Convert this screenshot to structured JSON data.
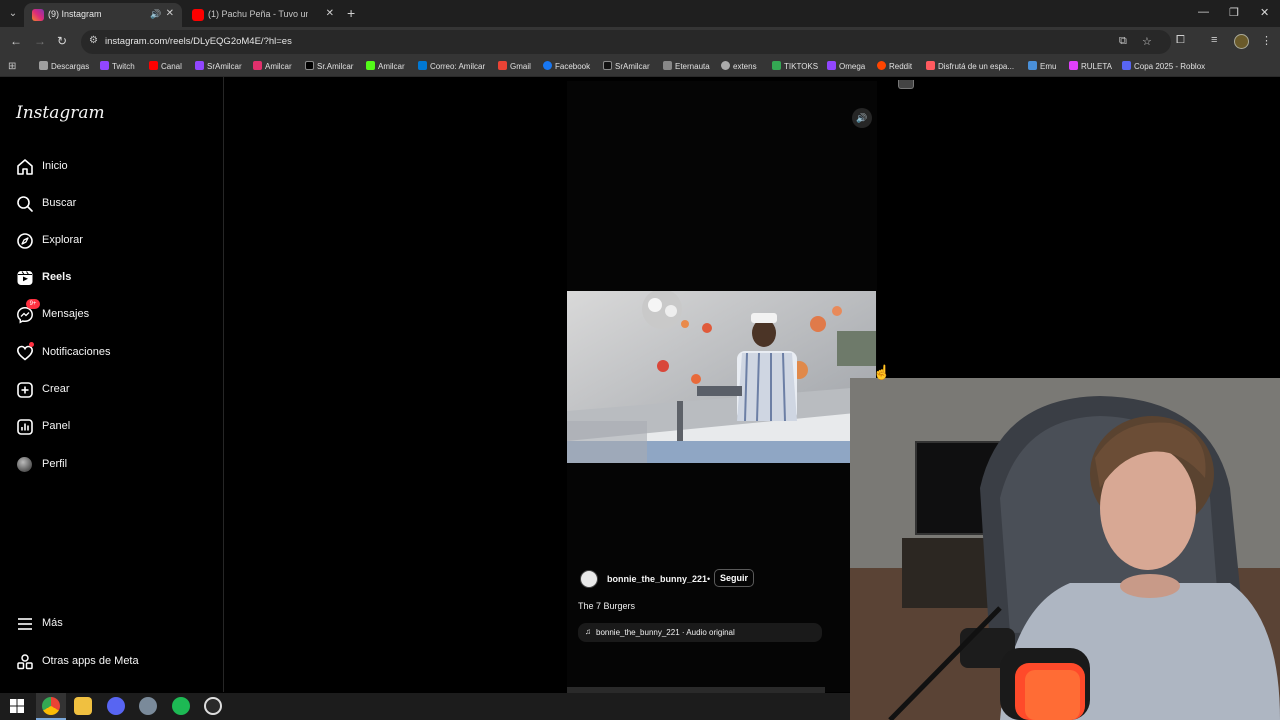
{
  "browser": {
    "tabs": [
      {
        "title": "(9) Instagram",
        "active": true
      },
      {
        "title": "(1) Pachu Peña - Tuvo un accid",
        "active": false
      }
    ],
    "url": "instagram.com/reels/DLyEQG2oM4E/?hl=es",
    "bookmarks": [
      {
        "label": "Descargas",
        "color": "#9e9e9e"
      },
      {
        "label": "Twitch",
        "color": "#9146ff"
      },
      {
        "label": "Canal",
        "color": "#ff0000"
      },
      {
        "label": "SrAmilcar",
        "color": "#9146ff"
      },
      {
        "label": "Amilcar",
        "color": "#e1306c"
      },
      {
        "label": "Sr.Amilcar",
        "color": "#000000"
      },
      {
        "label": "Amilcar",
        "color": "#53fc18"
      },
      {
        "label": "Correo: Amilcar",
        "color": "#0078d4"
      },
      {
        "label": "Gmail",
        "color": "#ea4335"
      },
      {
        "label": "Facebook",
        "color": "#1877f2"
      },
      {
        "label": "SrAmilcar",
        "color": "#111111"
      },
      {
        "label": "Eternauta",
        "color": "#888888"
      },
      {
        "label": "extens",
        "color": "#aaaaaa"
      },
      {
        "label": "TIKTOKS",
        "color": "#34a853"
      },
      {
        "label": "Omega",
        "color": "#9146ff"
      },
      {
        "label": "Reddit",
        "color": "#ff4500"
      },
      {
        "label": "Disfrutá de un espa...",
        "color": "#ff5a5f"
      },
      {
        "label": "Emu",
        "color": "#4a90d9"
      },
      {
        "label": "RULETA",
        "color": "#e040fb"
      },
      {
        "label": "Copa 2025 - Roblox",
        "color": "#5865f2"
      }
    ]
  },
  "sidebar": {
    "logo": "Instagram",
    "items": [
      {
        "label": "Inicio",
        "icon": "home-icon"
      },
      {
        "label": "Buscar",
        "icon": "search-icon"
      },
      {
        "label": "Explorar",
        "icon": "compass-icon"
      },
      {
        "label": "Reels",
        "icon": "reels-icon"
      },
      {
        "label": "Mensajes",
        "icon": "messenger-icon",
        "badge": "9+"
      },
      {
        "label": "Notificaciones",
        "icon": "heart-icon"
      },
      {
        "label": "Crear",
        "icon": "plus-square-icon"
      },
      {
        "label": "Panel",
        "icon": "bar-chart-icon"
      },
      {
        "label": "Perfil",
        "icon": "avatar"
      }
    ],
    "bottom": [
      {
        "label": "Más",
        "icon": "hamburger-icon"
      },
      {
        "label": "Otras apps de Meta",
        "icon": "meta-apps-icon"
      }
    ]
  },
  "reel": {
    "author": "bonnie_the_bunny_221",
    "separator": "•",
    "follow_label": "Seguir",
    "caption": "The 7 Burgers",
    "audio": "bonnie_the_bunny_221 · Audio original"
  },
  "colors": {
    "accent_badge": "#ff3040",
    "background": "#000000"
  }
}
